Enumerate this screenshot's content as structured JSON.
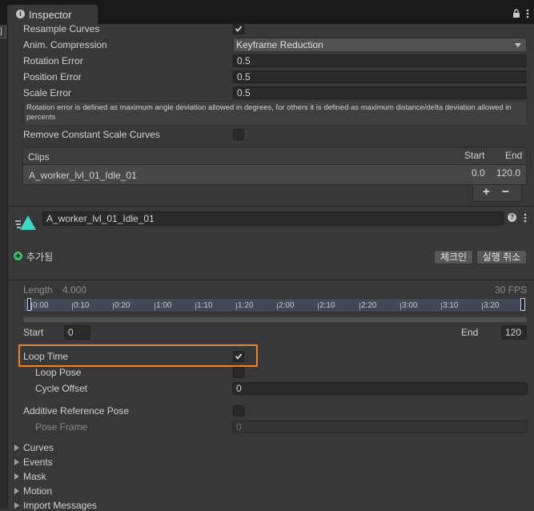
{
  "tab": {
    "title": "Inspector",
    "info_icon": "info-icon",
    "lock_icon": "lock-icon",
    "menu_icon": "more-vertical-icon"
  },
  "left_strip": {
    "label": "]"
  },
  "import_settings": {
    "resample_curves": {
      "label": "Resample Curves",
      "checked": true
    },
    "anim_compression": {
      "label": "Anim. Compression",
      "value": "Keyframe Reduction"
    },
    "rotation_error": {
      "label": "Rotation Error",
      "value": "0.5"
    },
    "position_error": {
      "label": "Position Error",
      "value": "0.5"
    },
    "scale_error": {
      "label": "Scale Error",
      "value": "0.5"
    },
    "help_text": "Rotation error is defined as maximum angle deviation allowed in degrees, for others it is defined as maximum distance/delta deviation allowed in percents",
    "remove_constant_scale_curves": {
      "label": "Remove Constant Scale Curves",
      "checked": false
    }
  },
  "clips": {
    "header": {
      "name": "Clips",
      "start": "Start",
      "end": "End"
    },
    "rows": [
      {
        "name": "A_worker_lvl_01_Idle_01",
        "start": "0.0",
        "end": "120.0"
      }
    ],
    "add_label": "+",
    "remove_label": "−"
  },
  "clip_header": {
    "name": "A_worker_lvl_01_Idle_01",
    "help_icon": "help-icon",
    "menu_icon": "more-vertical-icon",
    "added_label": "추가됨",
    "checkin_label": "체크인",
    "revert_label": "실행 취소"
  },
  "timeline": {
    "length_label": "Length",
    "length_value": "4.000",
    "fps": "30 FPS",
    "ticks": [
      "0:00",
      "0:10",
      "0:20",
      "1:00",
      "1:10",
      "1:20",
      "2:00",
      "2:10",
      "2:20",
      "3:00",
      "3:10",
      "3:20"
    ]
  },
  "range": {
    "start_label": "Start",
    "start_value": "0",
    "end_label": "End",
    "end_value": "120"
  },
  "loop": {
    "loop_time": {
      "label": "Loop Time",
      "checked": true
    },
    "loop_pose": {
      "label": "Loop Pose",
      "checked": false
    },
    "cycle_offset": {
      "label": "Cycle Offset",
      "value": "0"
    },
    "highlight_color": "#e8852a"
  },
  "additive": {
    "additive_reference_pose": {
      "label": "Additive Reference Pose",
      "checked": false
    },
    "pose_frame": {
      "label": "Pose Frame",
      "value": "0"
    }
  },
  "foldouts": [
    "Curves",
    "Events",
    "Mask",
    "Motion",
    "Import Messages"
  ],
  "colors": {
    "accent_teal": "#3ad9c8",
    "added_green": "#3cc06a",
    "background": "#383838",
    "field": "#2a2a2a"
  }
}
